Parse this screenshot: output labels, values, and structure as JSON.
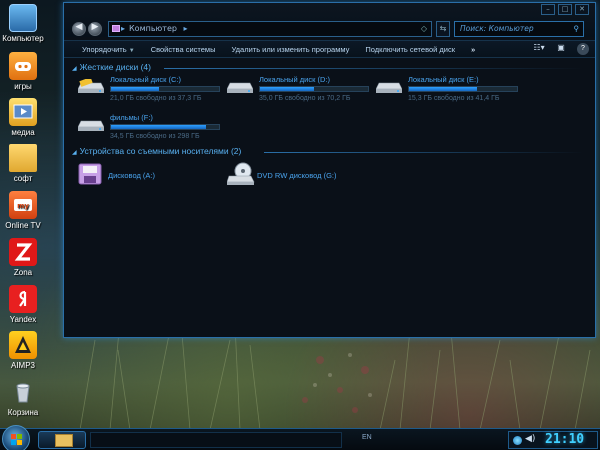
{
  "desktop": {
    "icons": [
      {
        "label": "Компьютер",
        "icon": "computer-icon"
      },
      {
        "label": "игры",
        "icon": "gamepad-icon"
      },
      {
        "label": "медиа",
        "icon": "media-icon"
      },
      {
        "label": "софт",
        "icon": "folder-icon"
      },
      {
        "label": "Online TV",
        "icon": "tv-icon"
      },
      {
        "label": "Zona",
        "icon": "zona-icon"
      },
      {
        "label": "Yandex",
        "icon": "yandex-icon"
      },
      {
        "label": "AIMP3",
        "icon": "aimp-icon"
      },
      {
        "label": "Корзина",
        "icon": "recycle-bin-icon"
      }
    ]
  },
  "window": {
    "address": "Компьютер",
    "search_placeholder": "Поиск: Компьютер",
    "toolbar": {
      "organize": "Упорядочить",
      "system_properties": "Свойства системы",
      "uninstall": "Удалить или изменить программу",
      "map_drive": "Подключить сетевой диск",
      "more": "»"
    },
    "hard_drives_header": "Жесткие диски (4)",
    "drives": [
      {
        "name": "Локальный диск (C:)",
        "free": "21,0 ГБ свободно из 37,3 ГБ",
        "used_fraction": 0.44
      },
      {
        "name": "Локальный диск (D:)",
        "free": "35,0 ГБ свободно из 70,2 ГБ",
        "used_fraction": 0.5
      },
      {
        "name": "Локальный диск (E:)",
        "free": "15,3 ГБ свободно из 41,4 ГБ",
        "used_fraction": 0.63
      },
      {
        "name": "фильмы (F:)",
        "free": "34,5 ГБ свободно из 298 ГБ",
        "used_fraction": 0.88
      }
    ],
    "removable_header": "Устройства со съемными носителями (2)",
    "removable": [
      {
        "name": "Дисковод (A:)",
        "icon": "floppy-drive-icon"
      },
      {
        "name": "DVD RW дисковод (G:)",
        "icon": "dvd-drive-icon"
      }
    ]
  },
  "taskbar": {
    "language": "EN",
    "clock": "21:10"
  },
  "colors": {
    "accent": "#2a6fa8",
    "link": "#4aa4ee",
    "bar_fill": "#2ea0ff",
    "clock": "#40d0ff"
  }
}
